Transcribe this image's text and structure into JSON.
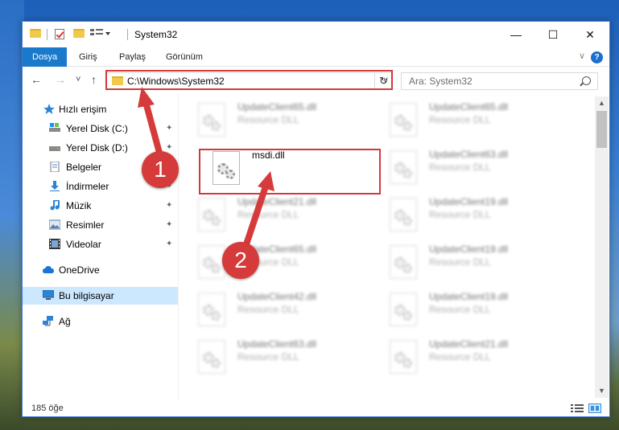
{
  "window": {
    "title": "System32",
    "minimize": "—",
    "maximize": "☐",
    "close": "✕"
  },
  "ribbon": {
    "tabs": [
      "Dosya",
      "Giriş",
      "Paylaş",
      "Görünüm"
    ],
    "help": "?",
    "expand": "∨"
  },
  "nav": {
    "back": "←",
    "forward": "→",
    "recent": "˅",
    "up": "↑",
    "address": "C:\\Windows\\System32",
    "address_dropdown": "∨",
    "refresh": "↻",
    "search_placeholder": "Ara: System32"
  },
  "sidebar": {
    "items": [
      {
        "label": "Hızlı erişim",
        "icon": "star-icon",
        "pinned": false
      },
      {
        "label": "Yerel Disk (C:)",
        "icon": "drive-icon",
        "pinned": true
      },
      {
        "label": "Yerel Disk (D:)",
        "icon": "drive-icon",
        "pinned": true
      },
      {
        "label": "Belgeler",
        "icon": "document-icon",
        "pinned": true
      },
      {
        "label": "İndirmeler",
        "icon": "download-icon",
        "pinned": true
      },
      {
        "label": "Müzik",
        "icon": "music-icon",
        "pinned": true
      },
      {
        "label": "Resimler",
        "icon": "picture-icon",
        "pinned": true
      },
      {
        "label": "Videolar",
        "icon": "video-icon",
        "pinned": true
      },
      {
        "label": "OneDrive",
        "icon": "cloud-icon",
        "pinned": false
      },
      {
        "label": "Bu bilgisayar",
        "icon": "computer-icon",
        "pinned": false,
        "selected": true
      },
      {
        "label": "Ağ",
        "icon": "network-icon",
        "pinned": false
      }
    ],
    "pin_glyph": "✦"
  },
  "files": {
    "highlighted": {
      "name": "msdi.dll",
      "type": ""
    },
    "blurred": [
      {
        "name": "UpdateClient65.dll",
        "type": "Resource DLL"
      },
      {
        "name": "UpdateClient65.dll",
        "type": "Resource DLL"
      },
      {
        "name": "UpdateClient63.dll",
        "type": "Resource DLL"
      },
      {
        "name": "UpdateClient21.dll",
        "type": "Resource DLL"
      },
      {
        "name": "UpdateClient19.dll",
        "type": "Resource DLL"
      },
      {
        "name": "UpdateClient65.dll",
        "type": "Resource DLL"
      },
      {
        "name": "UpdateClient19.dll",
        "type": "Resource DLL"
      },
      {
        "name": "UpdateClient42.dll",
        "type": "Resource DLL"
      },
      {
        "name": "UpdateClient19.dll",
        "type": "Resource DLL"
      },
      {
        "name": "UpdateClient63.dll",
        "type": "Resource DLL"
      },
      {
        "name": "UpdateClient21.dll",
        "type": "Resource DLL"
      }
    ]
  },
  "scrollbar": {
    "up": "▲",
    "down": "▼"
  },
  "status": {
    "count": "185 öğe"
  },
  "callouts": {
    "one": "1",
    "two": "2"
  },
  "colors": {
    "accent": "#1979ca",
    "annotation": "#d63b3b",
    "selected": "#cce8ff"
  }
}
